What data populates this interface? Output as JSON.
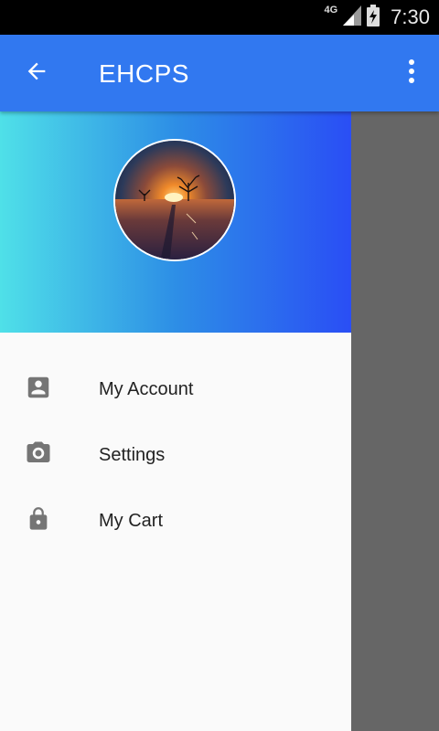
{
  "status_bar": {
    "network": "4G",
    "time": "7:30"
  },
  "app_bar": {
    "title": "EHCPS",
    "back_icon": "arrow-back-icon",
    "menu_icon": "more-vert-icon"
  },
  "drawer": {
    "header": {
      "gradient_start": "#4fe0e8",
      "gradient_end": "#2a4ef5",
      "avatar": "sunset-tree-photo"
    },
    "items": [
      {
        "label": "My Account",
        "icon": "account-box-icon"
      },
      {
        "label": "Settings",
        "icon": "camera-icon"
      },
      {
        "label": "My Cart",
        "icon": "lock-icon"
      }
    ]
  },
  "colors": {
    "app_bar": "#3178f0",
    "scrim": "#666666",
    "drawer_bg": "#fafafa",
    "icon": "#757575"
  }
}
